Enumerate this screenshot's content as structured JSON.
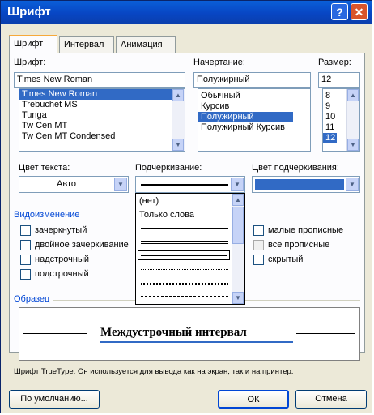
{
  "window": {
    "title": "Шрифт",
    "help_glyph": "?",
    "close_glyph": "✕"
  },
  "tabs": [
    {
      "label": "Шрифт",
      "active": true
    },
    {
      "label": "Интервал",
      "active": false
    },
    {
      "label": "Анимация",
      "active": false
    }
  ],
  "font": {
    "label": "Шрифт:",
    "value": "Times New Roman",
    "items": [
      "Times New Roman",
      "Trebuchet MS",
      "Tunga",
      "Tw Cen MT",
      "Tw Cen MT Condensed"
    ],
    "selected": "Times New Roman"
  },
  "style": {
    "label": "Начертание:",
    "value": "Полужирный",
    "items": [
      "Обычный",
      "Курсив",
      "Полужирный",
      "Полужирный Курсив"
    ],
    "selected": "Полужирный"
  },
  "size": {
    "label": "Размер:",
    "value": "12",
    "items": [
      "8",
      "9",
      "10",
      "11",
      "12"
    ],
    "selected": "12"
  },
  "font_color": {
    "label": "Цвет текста:",
    "value": "Авто"
  },
  "underline": {
    "label": "Подчеркивание:",
    "options": [
      "(нет)",
      "Только слова"
    ]
  },
  "underline_color": {
    "label": "Цвет подчеркивания:",
    "color": "#316ac5"
  },
  "effects": {
    "label": "Видоизменение",
    "left": [
      "зачеркнутый",
      "двойное зачеркивание",
      "надстрочный",
      "подстрочный"
    ],
    "right": [
      "малые прописные",
      "все прописные",
      "скрытый"
    ]
  },
  "preview": {
    "label": "Образец",
    "sample": "Междустрочный интервал",
    "note": "Шрифт TrueType. Он используется для вывода как на экран, так и на принтер."
  },
  "buttons": {
    "default": "По умолчанию...",
    "ok": "ОК",
    "cancel": "Отмена"
  },
  "icons": {
    "scroll_up": "▲",
    "scroll_down": "▼"
  },
  "colors": {
    "accent": "#316ac5",
    "title_bar": "#0846c4",
    "face": "#ece9d8"
  }
}
